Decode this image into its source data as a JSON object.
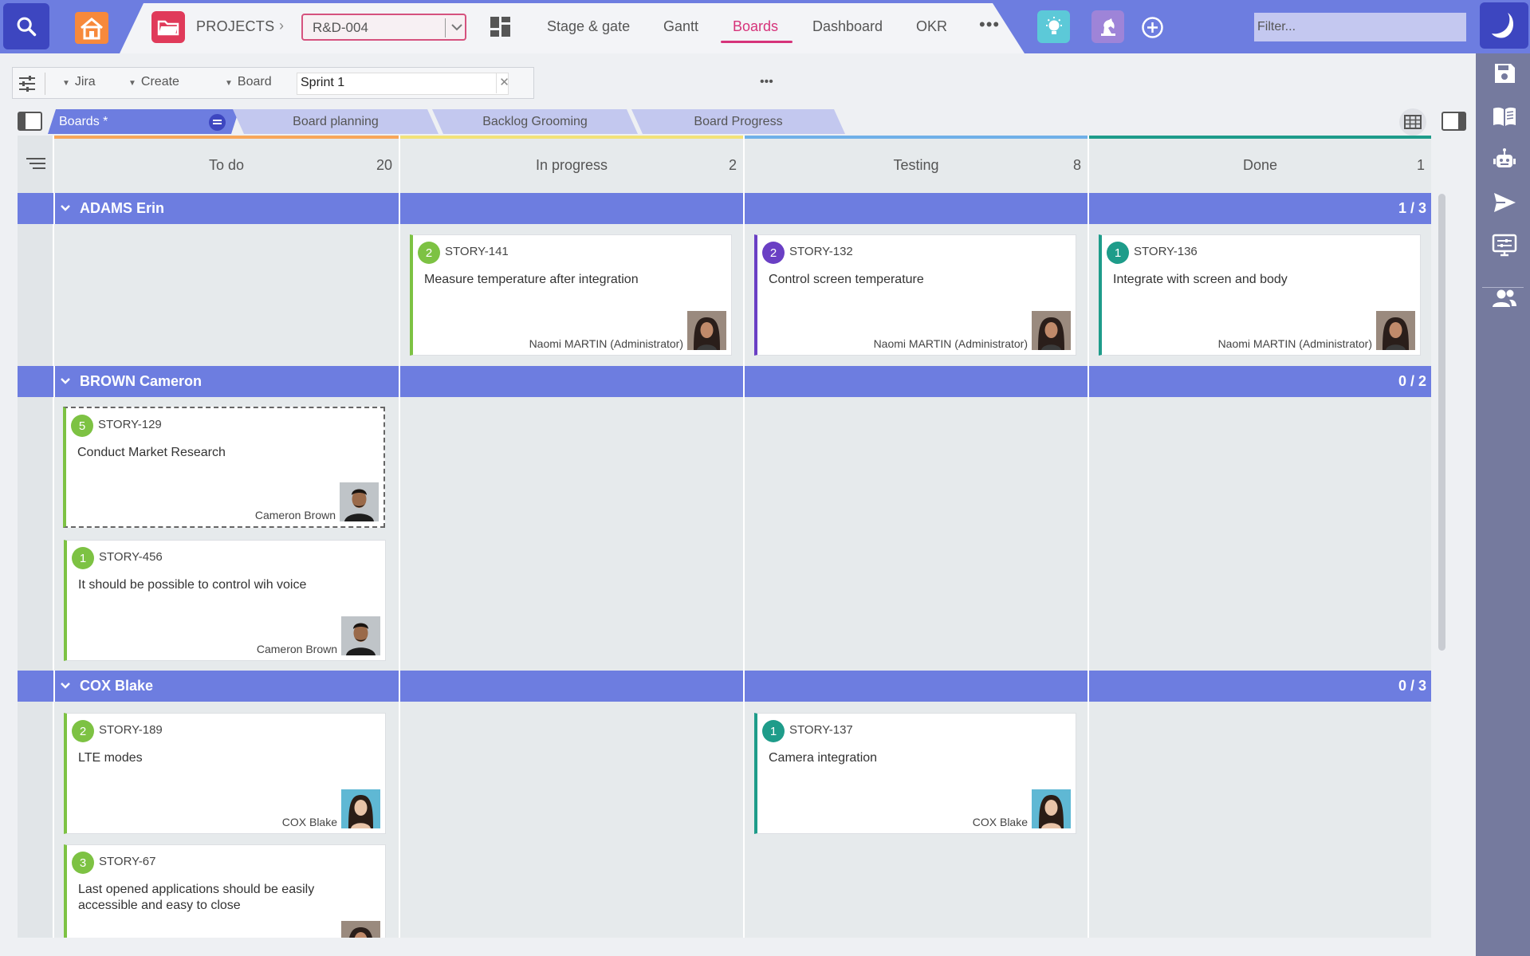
{
  "topbar": {
    "projects_label": "PROJECTS",
    "project_value": "R&D-004",
    "nav_tabs": [
      {
        "label": "Stage & gate"
      },
      {
        "label": "Gantt"
      },
      {
        "label": "Boards"
      },
      {
        "label": "Dashboard"
      },
      {
        "label": "OKR"
      }
    ],
    "active_tab": "Boards",
    "more": "•••",
    "filter_placeholder": "Filter..."
  },
  "toolbar": {
    "jira": "Jira",
    "create": "Create",
    "board": "Board",
    "sprint": "Sprint 1",
    "dots": "•••",
    "clear": "✕"
  },
  "view_tabs": [
    {
      "label": "Boards *"
    },
    {
      "label": "Board planning"
    },
    {
      "label": "Backlog Grooming"
    },
    {
      "label": "Board Progress"
    }
  ],
  "columns": [
    {
      "name": "To do",
      "count": "20",
      "color": "#f7a65a"
    },
    {
      "name": "In progress",
      "count": "2",
      "color": "#f2e27a"
    },
    {
      "name": "Testing",
      "count": "8",
      "color": "#6fb0e8"
    },
    {
      "name": "Done",
      "count": "1",
      "color": "#1e9c8a"
    }
  ],
  "swimlanes": [
    {
      "name": "ADAMS Erin",
      "count": "1 / 3"
    },
    {
      "name": "BROWN Cameron",
      "count": "0 / 2"
    },
    {
      "name": "COX Blake",
      "count": "0 / 3"
    }
  ],
  "cards": [
    {
      "points": "2",
      "key": "STORY-141",
      "title": "Measure temperature after integration",
      "assignee": "Naomi MARTIN (Administrator)",
      "color": "#7dc243",
      "avatar": "female-dark"
    },
    {
      "points": "2",
      "key": "STORY-132",
      "title": "Control screen temperature",
      "assignee": "Naomi MARTIN (Administrator)",
      "color": "#6a3fc4",
      "avatar": "female-dark"
    },
    {
      "points": "1",
      "key": "STORY-136",
      "title": "Integrate with screen and body",
      "assignee": "Naomi MARTIN (Administrator)",
      "color": "#1e9c8a",
      "avatar": "female-dark"
    },
    {
      "points": "5",
      "key": "STORY-129",
      "title": "Conduct Market Research",
      "assignee": "Cameron Brown",
      "color": "#7dc243",
      "avatar": "male"
    },
    {
      "points": "1",
      "key": "STORY-456",
      "title": "It should be possible to control wih voice",
      "assignee": "Cameron Brown",
      "color": "#7dc243",
      "avatar": "male"
    },
    {
      "points": "2",
      "key": "STORY-189",
      "title": "LTE modes",
      "assignee": "COX Blake",
      "color": "#7dc243",
      "avatar": "female-light"
    },
    {
      "points": "1",
      "key": "STORY-137",
      "title": "Camera integration",
      "assignee": "COX Blake",
      "color": "#1e9c8a",
      "avatar": "female-light"
    },
    {
      "points": "3",
      "key": "STORY-67",
      "title": "Last opened applications should be easily accessible and easy to close",
      "assignee": "",
      "color": "#7dc243",
      "avatar": "female-dark"
    }
  ]
}
